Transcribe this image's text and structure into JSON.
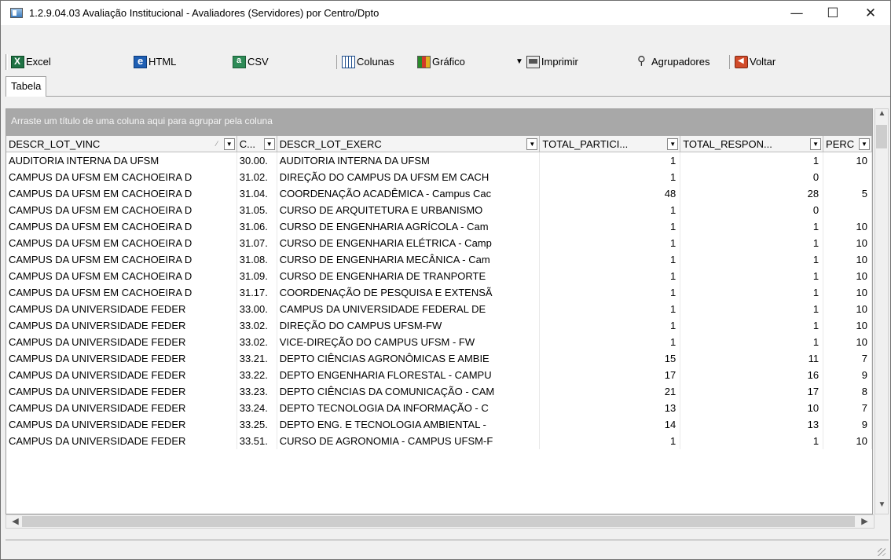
{
  "window": {
    "title": "1.2.9.04.03 Avaliação Institucional - Avaliadores (Servidores) por Centro/Dpto",
    "minimize": "—",
    "maximize": "☐",
    "close": "✕"
  },
  "toolbar": {
    "excel": "Excel",
    "html": "HTML",
    "csv": "CSV",
    "columns": "Colunas",
    "chart": "Gráfico",
    "print": "Imprimir",
    "groupers": "Agrupadores",
    "back": "Voltar"
  },
  "tabs": {
    "table": "Tabela"
  },
  "grid": {
    "group_hint": "Arraste um título de uma coluna aqui para agrupar pela coluna",
    "columns": [
      "DESCR_LOT_VINC",
      "C...",
      "DESCR_LOT_EXERC",
      "TOTAL_PARTICI...",
      "TOTAL_RESPON...",
      "PERC"
    ],
    "rows": [
      [
        "AUDITORIA INTERNA DA UFSM",
        "30.00.",
        "AUDITORIA INTERNA DA UFSM",
        "1",
        "1",
        "10"
      ],
      [
        "CAMPUS DA UFSM EM CACHOEIRA D",
        "31.02.",
        "DIREÇÃO DO CAMPUS DA UFSM EM CACH",
        "1",
        "0",
        ""
      ],
      [
        "CAMPUS DA UFSM EM CACHOEIRA D",
        "31.04.",
        "COORDENAÇÃO ACADÊMICA - Campus Cac",
        "48",
        "28",
        "5"
      ],
      [
        "CAMPUS DA UFSM EM CACHOEIRA D",
        "31.05.",
        "CURSO DE ARQUITETURA E URBANISMO",
        "1",
        "0",
        ""
      ],
      [
        "CAMPUS DA UFSM EM CACHOEIRA D",
        "31.06.",
        "CURSO DE ENGENHARIA AGRÍCOLA - Cam",
        "1",
        "1",
        "10"
      ],
      [
        "CAMPUS DA UFSM EM CACHOEIRA D",
        "31.07.",
        "CURSO DE ENGENHARIA ELÉTRICA - Camp",
        "1",
        "1",
        "10"
      ],
      [
        "CAMPUS DA UFSM EM CACHOEIRA D",
        "31.08.",
        "CURSO DE ENGENHARIA MECÂNICA - Cam",
        "1",
        "1",
        "10"
      ],
      [
        "CAMPUS DA UFSM EM CACHOEIRA D",
        "31.09.",
        "CURSO DE ENGENHARIA DE TRANPORTE",
        "1",
        "1",
        "10"
      ],
      [
        "CAMPUS DA UFSM EM CACHOEIRA D",
        "31.17.",
        "COORDENAÇÃO DE PESQUISA E EXTENSÃ",
        "1",
        "1",
        "10"
      ],
      [
        "CAMPUS DA UNIVERSIDADE FEDER",
        "33.00.",
        "CAMPUS DA UNIVERSIDADE FEDERAL DE",
        "1",
        "1",
        "10"
      ],
      [
        "CAMPUS DA UNIVERSIDADE FEDER",
        "33.02.",
        "DIREÇÃO DO CAMPUS UFSM-FW",
        "1",
        "1",
        "10"
      ],
      [
        "CAMPUS DA UNIVERSIDADE FEDER",
        "33.02.",
        "VICE-DIREÇÃO DO CAMPUS UFSM - FW",
        "1",
        "1",
        "10"
      ],
      [
        "CAMPUS DA UNIVERSIDADE FEDER",
        "33.21.",
        "DEPTO CIÊNCIAS AGRONÔMICAS E AMBIE",
        "15",
        "11",
        "7"
      ],
      [
        "CAMPUS DA UNIVERSIDADE FEDER",
        "33.22.",
        "DEPTO ENGENHARIA FLORESTAL - CAMPU",
        "17",
        "16",
        "9"
      ],
      [
        "CAMPUS DA UNIVERSIDADE FEDER",
        "33.23.",
        "DEPTO CIÊNCIAS DA COMUNICAÇÃO - CAM",
        "21",
        "17",
        "8"
      ],
      [
        "CAMPUS DA UNIVERSIDADE FEDER",
        "33.24.",
        "DEPTO TECNOLOGIA DA INFORMAÇÃO - C",
        "13",
        "10",
        "7"
      ],
      [
        "CAMPUS DA UNIVERSIDADE FEDER",
        "33.25.",
        "DEPTO ENG. E TECNOLOGIA AMBIENTAL -",
        "14",
        "13",
        "9"
      ],
      [
        "CAMPUS DA UNIVERSIDADE FEDER",
        "33.51.",
        "CURSO DE AGRONOMIA - CAMPUS UFSM-F",
        "1",
        "1",
        "10"
      ]
    ]
  }
}
